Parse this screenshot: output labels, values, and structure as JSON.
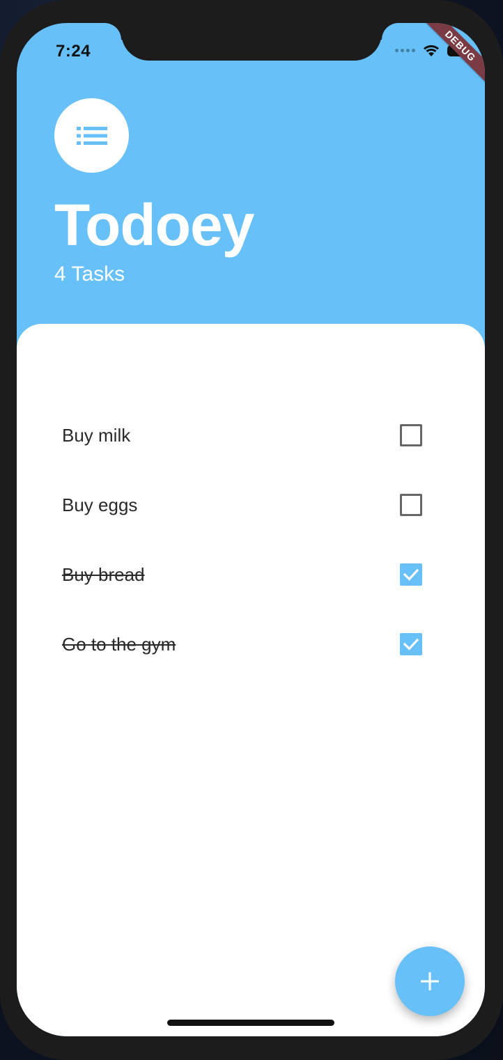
{
  "status_bar": {
    "time": "7:24",
    "signal_icon": "cellular-dots-icon",
    "wifi_icon": "wifi-icon",
    "battery_icon": "battery-icon"
  },
  "debug_banner": {
    "label": "DEBUG",
    "color": "#7a3b44"
  },
  "header": {
    "logo_icon": "list-icon",
    "title": "Todoey",
    "subtitle": "4 Tasks",
    "background_color": "#67c0f8"
  },
  "tasks": [
    {
      "title": "Buy milk",
      "done": false
    },
    {
      "title": "Buy eggs",
      "done": false
    },
    {
      "title": "Buy bread",
      "done": true
    },
    {
      "title": "Go to the gym",
      "done": true
    }
  ],
  "fab": {
    "icon": "add-icon",
    "color": "#67c0f8"
  }
}
